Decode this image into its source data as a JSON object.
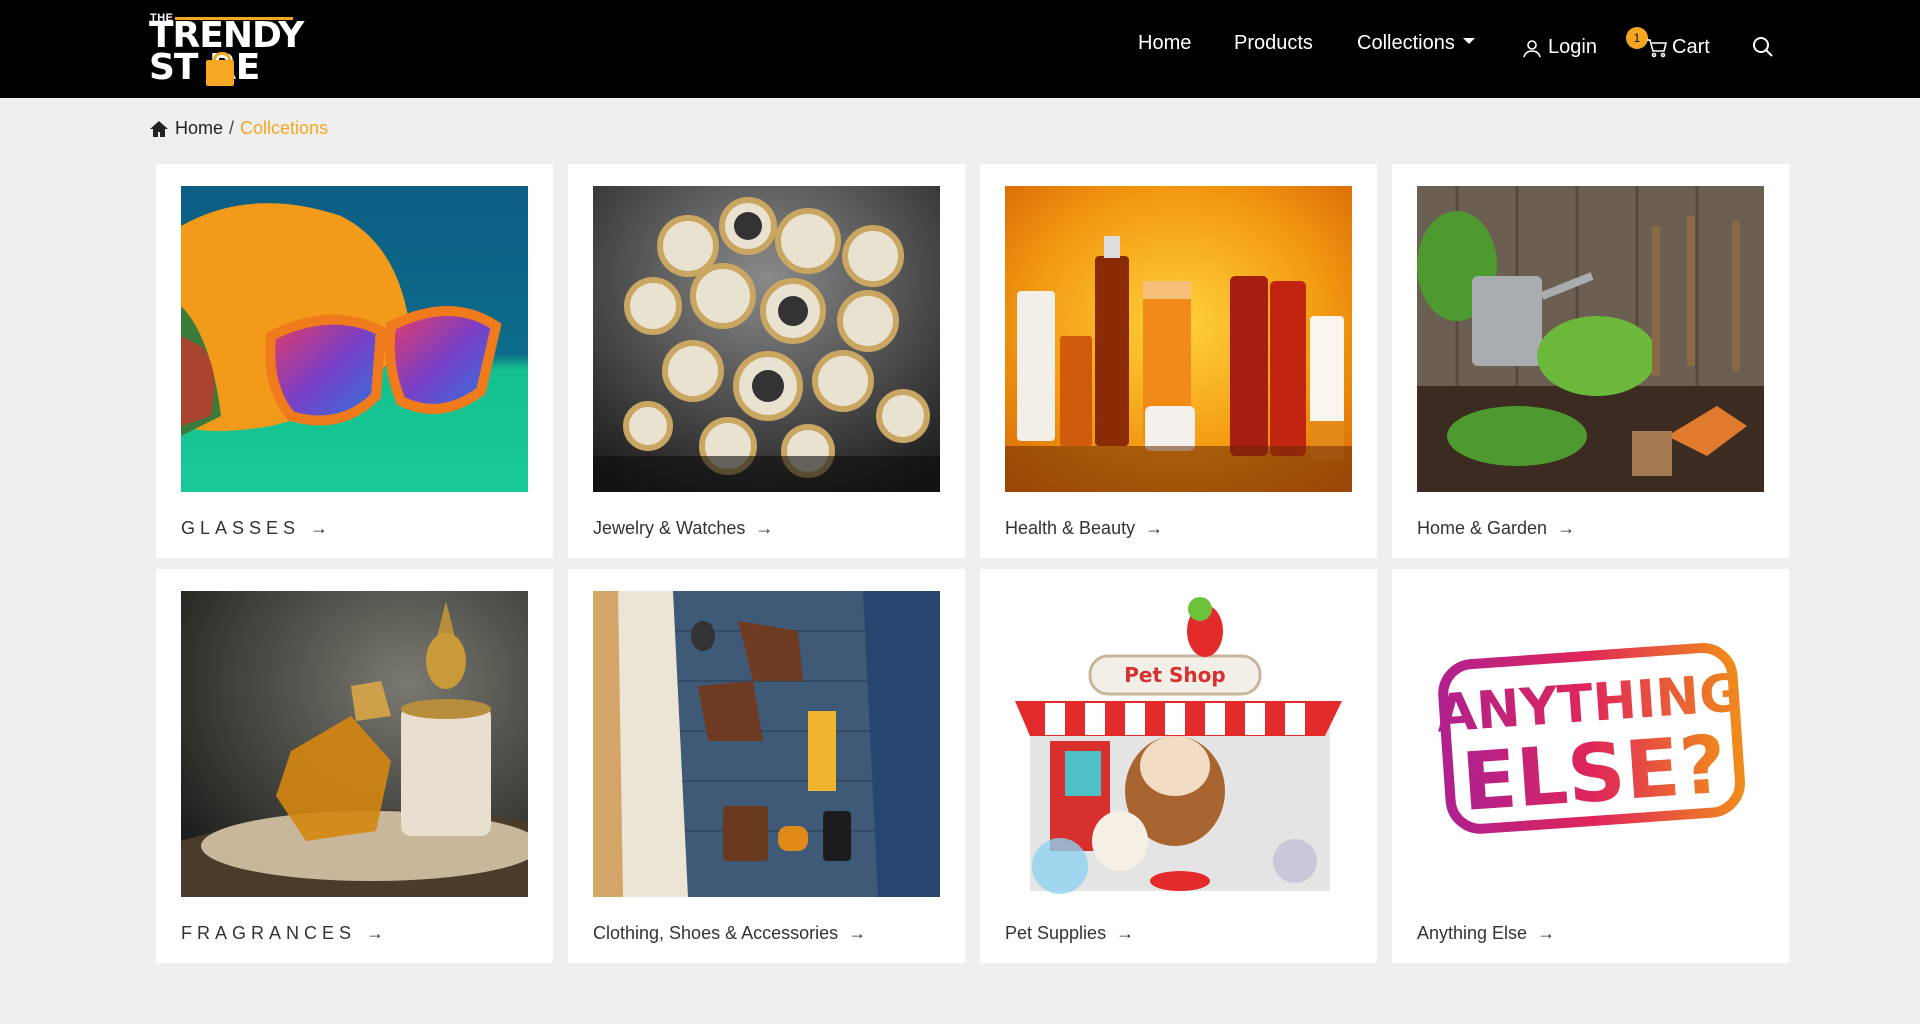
{
  "brand": {
    "the": "THE",
    "word1": "TRENDY",
    "word2": "ST  RE",
    "accent_color": "#f5a623"
  },
  "nav": {
    "home": "Home",
    "products": "Products",
    "collections": "Collections",
    "login": "Login",
    "cart": "Cart",
    "cart_count": "1",
    "icons": [
      "user-icon",
      "cart-icon",
      "search-icon",
      "chevron-down-icon"
    ]
  },
  "breadcrumb": {
    "home": "Home",
    "separator": "/",
    "current": "Collcetions"
  },
  "collections": [
    {
      "label": "GLASSES",
      "image": "sunglasses-photo"
    },
    {
      "label": "Jewelry & Watches",
      "image": "watches-photo"
    },
    {
      "label": "Health & Beauty",
      "image": "cosmetics-photo"
    },
    {
      "label": "Home & Garden",
      "image": "garden-tools-photo"
    },
    {
      "label": "FRAGRANCES",
      "image": "perfume-photo"
    },
    {
      "label": "Clothing, Shoes & Accessories",
      "image": "clothing-flatlay-photo"
    },
    {
      "label": "Pet Supplies",
      "image": "pet-shop-illustration"
    },
    {
      "label": "Anything Else",
      "image": "anything-else-stamp"
    }
  ],
  "stamp": {
    "line1": "ANYTHING",
    "line2": "ELSE?"
  },
  "petshop_sign": "Pet Shop",
  "arrow": "→"
}
